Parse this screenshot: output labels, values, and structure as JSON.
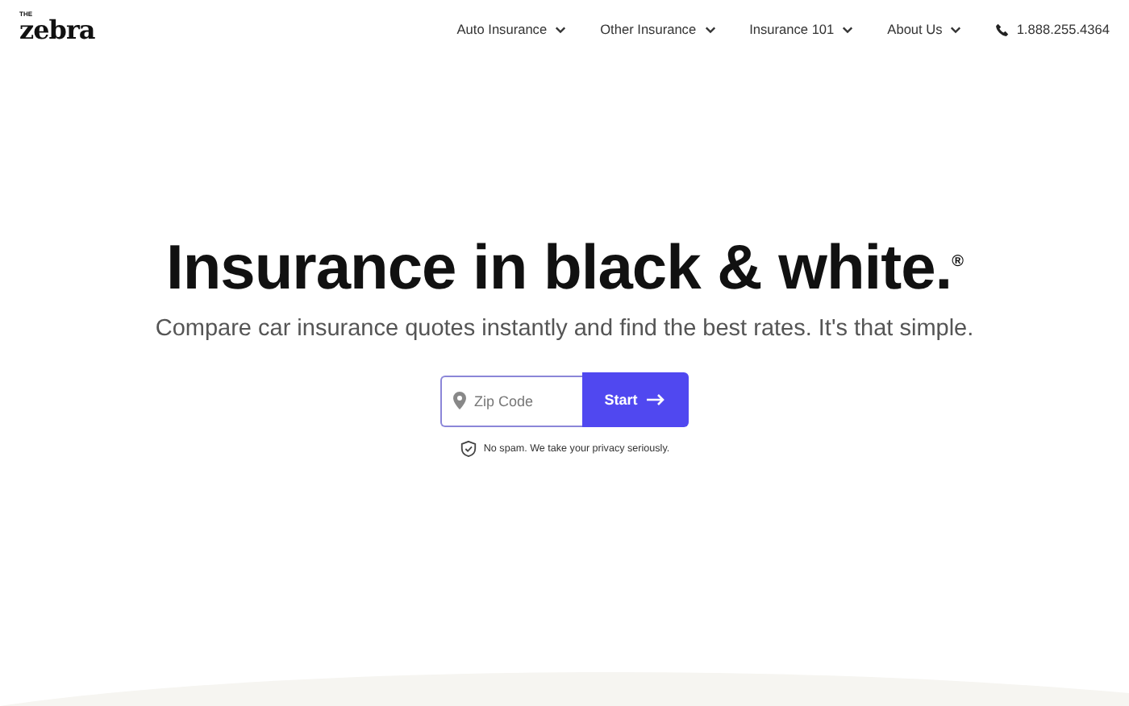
{
  "logo": {
    "small": "THE",
    "main": "zebra"
  },
  "nav": {
    "items": [
      {
        "label": "Auto Insurance"
      },
      {
        "label": "Other Insurance"
      },
      {
        "label": "Insurance 101"
      },
      {
        "label": "About Us"
      }
    ],
    "phone": "1.888.255.4364"
  },
  "hero": {
    "title": "Insurance in black & white.$^{®}$",
    "subtitle": "Compare car insurance quotes instantly and find the best rates. It's that simple.",
    "zip": {
      "placeholder": "Zip Code"
    },
    "button": "Start",
    "note": "No spam. We take your privacy seriously."
  }
}
